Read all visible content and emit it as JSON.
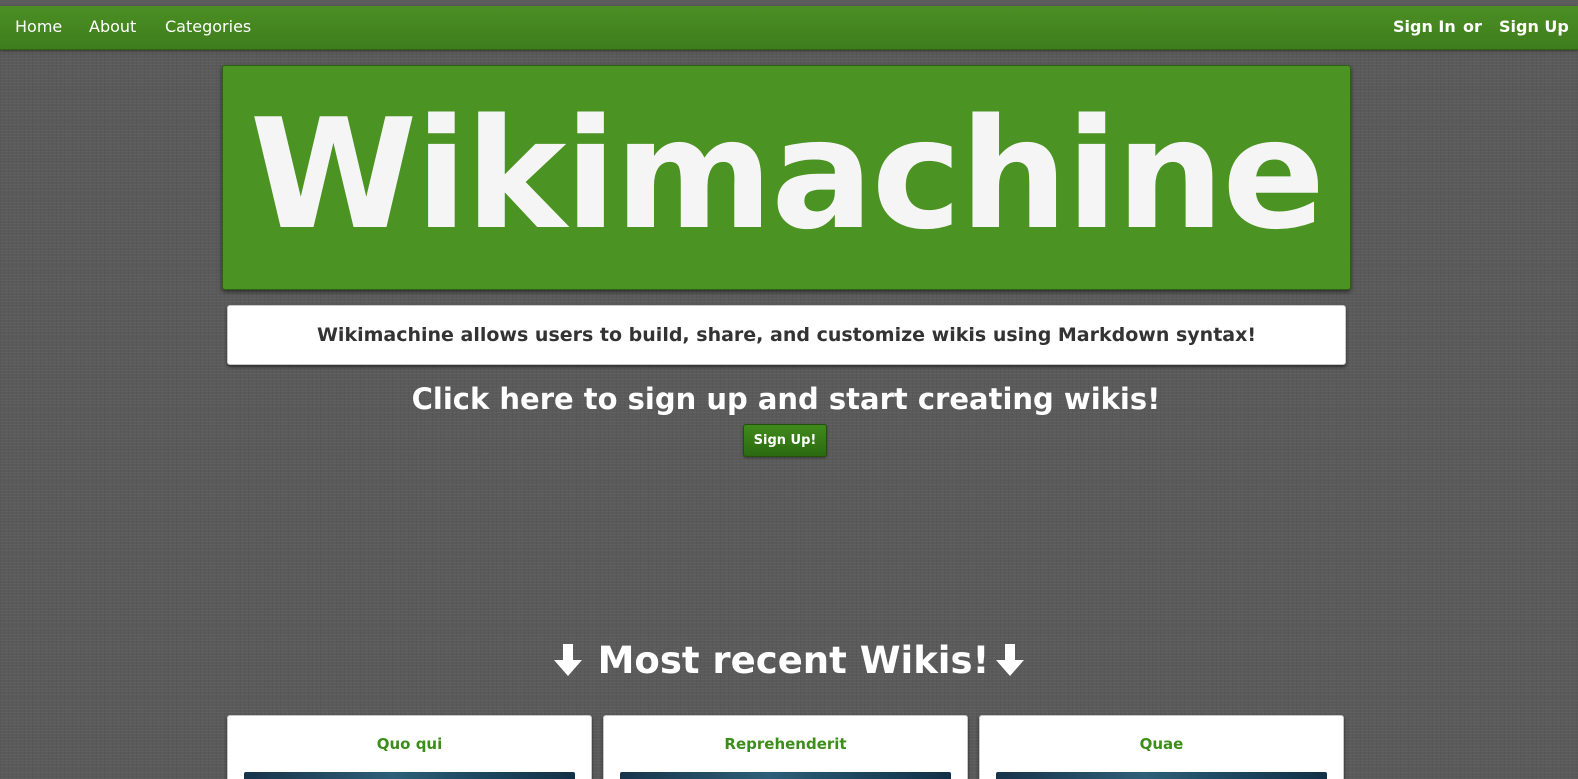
{
  "nav": {
    "links": [
      "Home",
      "About",
      "Categories"
    ],
    "sign_in": "Sign In",
    "or": "or",
    "sign_up": "Sign Up"
  },
  "banner": {
    "title": "Wikimachine"
  },
  "tagline": "Wikimachine allows users to build, share, and customize wikis using Markdown syntax!",
  "cta": {
    "heading": "Click here to sign up and start creating wikis!",
    "button": "Sign Up!"
  },
  "recent": {
    "heading": "Most recent Wikis!",
    "arrow_icon": "arrow-down-icon",
    "cards": [
      {
        "title": "Quo qui"
      },
      {
        "title": "Reprehenderit"
      },
      {
        "title": "Quae"
      }
    ]
  },
  "colors": {
    "brand_green": "#4b9322",
    "navbar_green": "#44861f",
    "card_title_green": "#3c8d1a",
    "background_gray": "#5a5a5a"
  }
}
